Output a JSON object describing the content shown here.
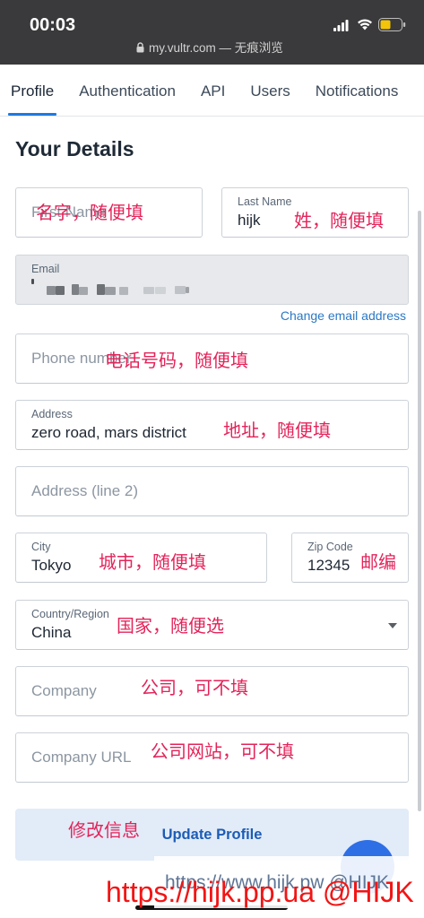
{
  "status_bar": {
    "time": "00:03",
    "url": "my.vultr.com — 无痕浏览",
    "battery_level": 0.5
  },
  "tabs": [
    {
      "label": "Profile",
      "active": true
    },
    {
      "label": "Authentication",
      "active": false
    },
    {
      "label": "API",
      "active": false
    },
    {
      "label": "Users",
      "active": false
    },
    {
      "label": "Notifications",
      "active": false
    }
  ],
  "page_title": "Your Details",
  "form": {
    "first_name": {
      "placeholder": "First Name"
    },
    "last_name": {
      "label": "Last Name",
      "value": "hijk"
    },
    "email": {
      "label": "Email"
    },
    "change_email_link": "Change email address",
    "phone": {
      "placeholder": "Phone number"
    },
    "address": {
      "label": "Address",
      "value": "zero road, mars district"
    },
    "address_line2": {
      "placeholder": "Address (line 2)"
    },
    "city": {
      "label": "City",
      "value": "Tokyo"
    },
    "zip": {
      "label": "Zip Code",
      "value": "12345"
    },
    "country": {
      "label": "Country/Region",
      "value": "China"
    },
    "company": {
      "placeholder": "Company"
    },
    "company_url": {
      "placeholder": "Company URL"
    },
    "submit_label": "Update Profile"
  },
  "annotations": {
    "first_name": "名字，随便填",
    "last_name": "姓，随便填",
    "phone": "电话号码，随便填",
    "address": "地址，随便填",
    "city": "城市，随便填",
    "zip": "邮编",
    "country": "国家，随便选",
    "company": "公司，可不填",
    "company_url": "公司网站，可不填",
    "update": "修改信息"
  },
  "watermarks": {
    "faint": "https://www.hijk.pw @HIJK",
    "main": "https://hijk.pp.ua @HIJK"
  },
  "icons": {
    "signal": "signal-icon",
    "wifi": "wifi-icon",
    "battery": "battery-icon",
    "lock": "lock-icon",
    "dropdown": "chevron-down-icon"
  },
  "colors": {
    "accent": "#1d7ae2",
    "annotation": "#e3245a",
    "watermark_red": "#f21515",
    "button_bg": "#e2ebf8",
    "button_text": "#1c5cb5",
    "link": "#2b78c5",
    "chat_button": "#2e6fe6",
    "status_bar_bg": "#3a3a3c",
    "battery": "#f3c409"
  }
}
